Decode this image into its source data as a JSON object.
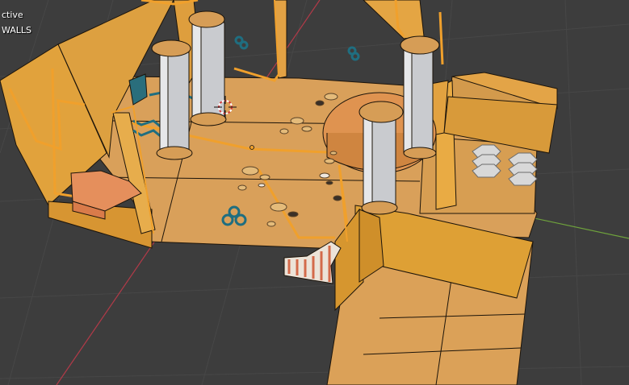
{
  "viewport": {
    "mode_text": "ctive",
    "collection_text": "WALLS",
    "x_axis_color": "#b23a48",
    "y_axis_color": "#6fa33c",
    "grid_color": "#474747",
    "background_color": "#3d3d3d",
    "floor_color": "#d9a05a",
    "wall_color": "#e1a23c",
    "wall_edge_color": "#1c140a",
    "selected_edge_color": "#f0a02c",
    "pillar_color": "#c9cbcf",
    "cap_color": "#d69d56",
    "honeycomb_color": "#1f6e80",
    "rock_color": "#d8d8d8",
    "cursor_icon": "3d-cursor-icon"
  }
}
